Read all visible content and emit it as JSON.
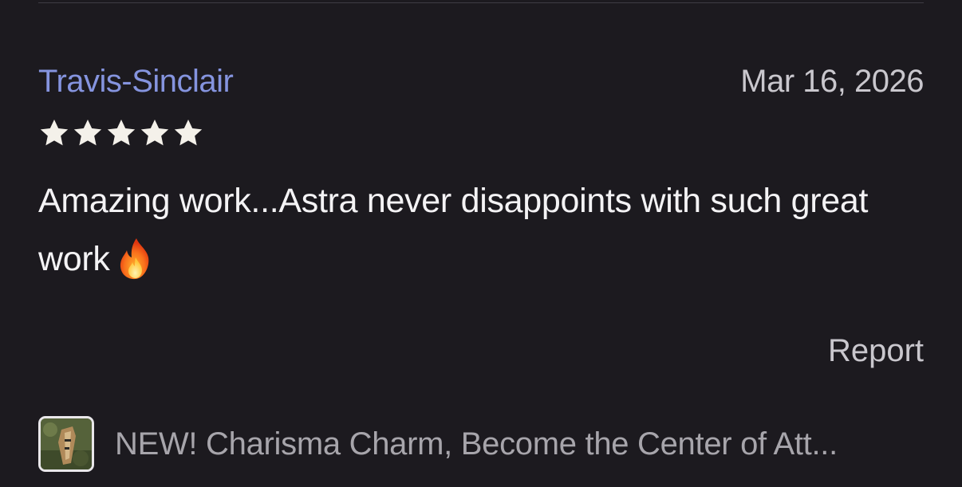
{
  "review": {
    "author": "Travis-Sinclair",
    "date": "Mar 16, 2026",
    "rating": 5,
    "rating_max": 5,
    "text": "Amazing work...Astra never disappoints with such great work",
    "emoji_icon": "fire-icon",
    "report_label": "Report"
  },
  "product": {
    "title": "NEW! Charisma Charm, Become the Center of Att..."
  },
  "colors": {
    "background": "#1c1a1f",
    "author_link": "#8594df",
    "star": "#f4f1ea",
    "body_text": "#f4f3f5",
    "muted_text": "#c9c7cd"
  }
}
